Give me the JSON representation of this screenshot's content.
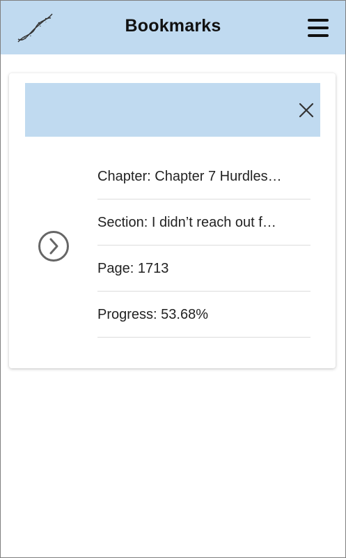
{
  "header": {
    "title": "Bookmarks",
    "logo_icon": "dna-helix-icon",
    "menu_icon": "hamburger-menu-icon",
    "background": "#c0daf0"
  },
  "bookmark": {
    "close_icon": "close-icon",
    "open_icon": "chevron-right-circle-icon",
    "chapter_label": "Chapter: ",
    "chapter_value": "Chapter 7 Hurdles…",
    "section_label": "Section: ",
    "section_value": "I didn’t reach out f…",
    "page_label": "Page: ",
    "page_value": "1713",
    "progress_label": "Progress: ",
    "progress_value": "53.68%"
  }
}
